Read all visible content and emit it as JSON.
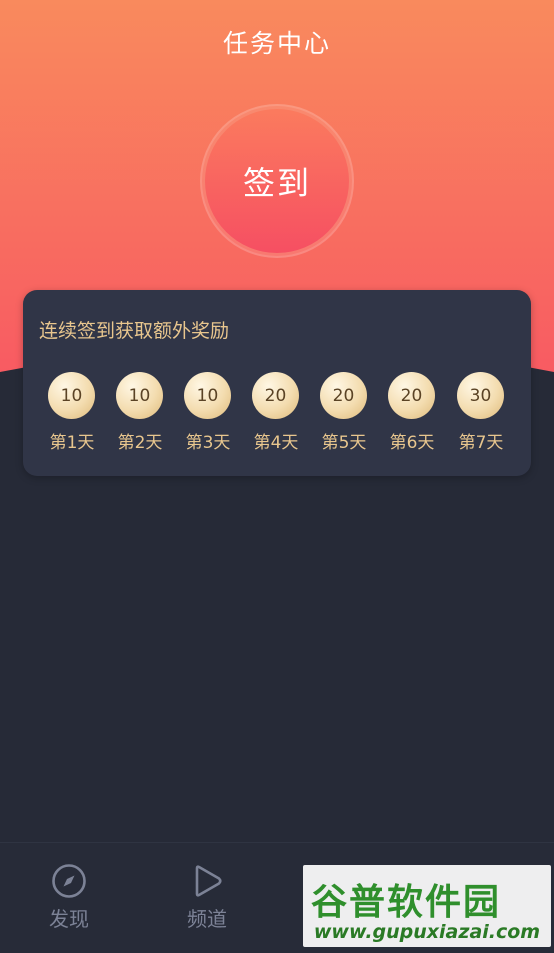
{
  "header": {
    "title": "任务中心"
  },
  "signin": {
    "label": "签到"
  },
  "streak": {
    "title": "连续签到获取额外奖励",
    "days": [
      {
        "reward": "10",
        "label": "第1天"
      },
      {
        "reward": "10",
        "label": "第2天"
      },
      {
        "reward": "10",
        "label": "第3天"
      },
      {
        "reward": "20",
        "label": "第4天"
      },
      {
        "reward": "20",
        "label": "第5天"
      },
      {
        "reward": "20",
        "label": "第6天"
      },
      {
        "reward": "30",
        "label": "第7天"
      }
    ]
  },
  "tabbar": {
    "items": [
      {
        "label": "发现",
        "icon": "compass-icon"
      },
      {
        "label": "频道",
        "icon": "play-icon"
      }
    ]
  },
  "watermark": {
    "brand": "谷普软件园",
    "url": "www.gupuxiazai.com"
  },
  "colors": {
    "hero_top": "#f98a5d",
    "hero_bottom": "#f85b62",
    "background": "#262a37",
    "card": "#303547",
    "gold_text": "#e8c68e",
    "tab_text": "#7c8296"
  }
}
